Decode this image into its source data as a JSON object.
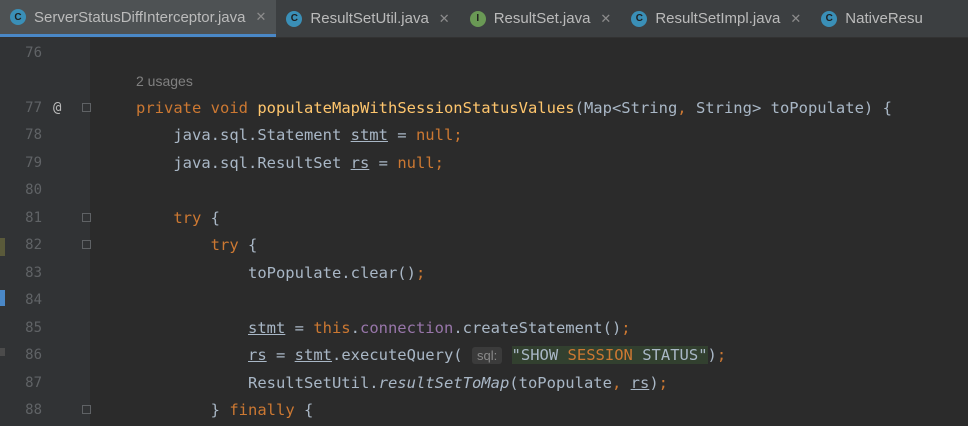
{
  "tabs": [
    {
      "name": "ServerStatusDiffInterceptor.java",
      "icon": "class-icon",
      "icon_letter": "C",
      "active": true,
      "close": "✕"
    },
    {
      "name": "ResultSetUtil.java",
      "icon": "class-icon",
      "icon_letter": "C",
      "active": false,
      "close": "✕"
    },
    {
      "name": "ResultSet.java",
      "icon": "interface-icon",
      "icon_letter": "I",
      "active": false,
      "close": "✕"
    },
    {
      "name": "ResultSetImpl.java",
      "icon": "class-icon",
      "icon_letter": "C",
      "active": false,
      "close": "✕"
    },
    {
      "name": "NativeResu",
      "icon": "class-icon",
      "icon_letter": "C",
      "active": false,
      "close": ""
    }
  ],
  "colors": {
    "class_icon": "#3a8fb7",
    "interface_icon": "#6a9955",
    "keyword": "#cc7832",
    "method": "#ffc66d",
    "field": "#9876aa",
    "string": "#6a8759"
  },
  "editor": {
    "usages_hint": "2 usages",
    "override_marker": "@",
    "inlay_hint": "sql:",
    "lines": [
      {
        "num": "76",
        "tokens": []
      },
      {
        "num": "77",
        "tokens": [
          {
            "t": "private",
            "c": "kw"
          },
          {
            "t": " "
          },
          {
            "t": "void",
            "c": "kw"
          },
          {
            "t": " "
          },
          {
            "t": "populateMapWithSessionStatusValues",
            "c": "fn"
          },
          {
            "t": "(Map<String"
          },
          {
            "t": ",",
            "c": "kw"
          },
          {
            "t": " String> toPopulate) {"
          }
        ]
      },
      {
        "num": "78",
        "tokens": [
          {
            "t": "    java.sql.Statement "
          },
          {
            "t": "stmt",
            "c": "uline"
          },
          {
            "t": " = "
          },
          {
            "t": "null",
            "c": "kw"
          },
          {
            "t": ";",
            "c": "kw"
          }
        ]
      },
      {
        "num": "79",
        "tokens": [
          {
            "t": "    java.sql.ResultSet "
          },
          {
            "t": "rs",
            "c": "uline"
          },
          {
            "t": " = "
          },
          {
            "t": "null",
            "c": "kw"
          },
          {
            "t": ";",
            "c": "kw"
          }
        ]
      },
      {
        "num": "80",
        "tokens": []
      },
      {
        "num": "81",
        "tokens": [
          {
            "t": "    "
          },
          {
            "t": "try",
            "c": "kw"
          },
          {
            "t": " {"
          }
        ]
      },
      {
        "num": "82",
        "tokens": [
          {
            "t": "        "
          },
          {
            "t": "try",
            "c": "kw"
          },
          {
            "t": " {"
          }
        ]
      },
      {
        "num": "83",
        "tokens": [
          {
            "t": "            toPopulate.clear()"
          },
          {
            "t": ";",
            "c": "kw"
          }
        ]
      },
      {
        "num": "84",
        "tokens": []
      },
      {
        "num": "85",
        "tokens": [
          {
            "t": "            "
          },
          {
            "t": "stmt",
            "c": "uline"
          },
          {
            "t": " = "
          },
          {
            "t": "this",
            "c": "kw"
          },
          {
            "t": "."
          },
          {
            "t": "connection",
            "c": "field"
          },
          {
            "t": ".createStatement()"
          },
          {
            "t": ";",
            "c": "kw"
          }
        ]
      },
      {
        "num": "86",
        "tokens": [
          {
            "t": "            "
          },
          {
            "t": "rs",
            "c": "uline"
          },
          {
            "t": " = "
          },
          {
            "t": "stmt",
            "c": "uline"
          },
          {
            "t": ".executeQuery( "
          },
          {
            "t": "sql:",
            "c": "hint"
          },
          {
            "t": " "
          },
          {
            "t": "\"SHOW ",
            "c": "strhl"
          },
          {
            "t": "SESSION",
            "c": "strhl strkw"
          },
          {
            "t": " STATUS\"",
            "c": "strhl"
          },
          {
            "t": ")"
          },
          {
            "t": ";",
            "c": "kw"
          }
        ]
      },
      {
        "num": "87",
        "tokens": [
          {
            "t": "            ResultSetUtil."
          },
          {
            "t": "resultSetToMap",
            "c": "ital"
          },
          {
            "t": "(toPopulate"
          },
          {
            "t": ",",
            "c": "kw"
          },
          {
            "t": " "
          },
          {
            "t": "rs",
            "c": "uline"
          },
          {
            "t": ")"
          },
          {
            "t": ";",
            "c": "kw"
          }
        ]
      },
      {
        "num": "88",
        "tokens": [
          {
            "t": "        } "
          },
          {
            "t": "finally",
            "c": "kw"
          },
          {
            "t": " {"
          }
        ]
      }
    ]
  }
}
